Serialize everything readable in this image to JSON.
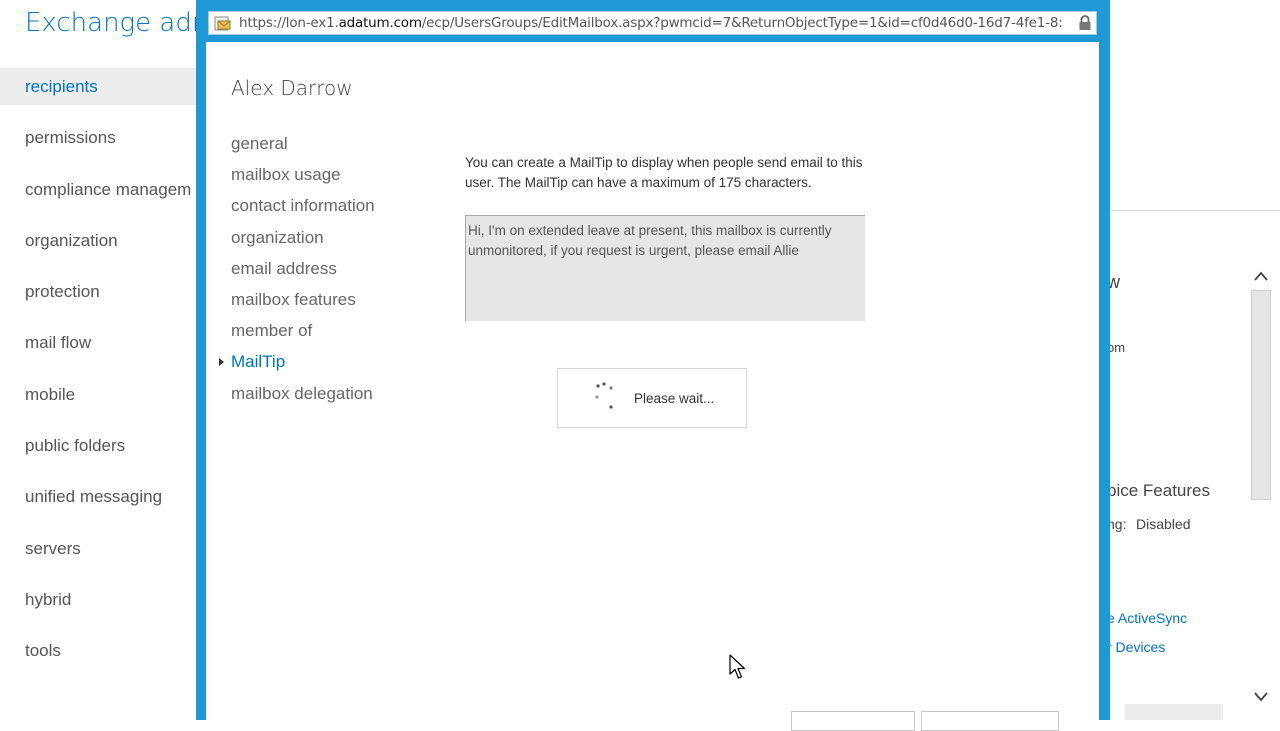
{
  "app": {
    "title": "Exchange adm"
  },
  "leftnav": {
    "items": [
      {
        "label": "recipients",
        "selected": true
      },
      {
        "label": "permissions"
      },
      {
        "label": "compliance managem"
      },
      {
        "label": "organization"
      },
      {
        "label": "protection"
      },
      {
        "label": "mail flow"
      },
      {
        "label": "mobile"
      },
      {
        "label": "public folders"
      },
      {
        "label": "unified messaging"
      },
      {
        "label": "servers"
      },
      {
        "label": "hybrid"
      },
      {
        "label": "tools"
      }
    ]
  },
  "right_panel": {
    "frag_w": "w",
    "frag_om": "om",
    "heading_partial": "pice Features",
    "status_label_partial": "ng:",
    "status_value": "Disabled",
    "link1_partial": "e ActiveSync",
    "link2_partial": "r Devices"
  },
  "browser": {
    "url_prefix": "https://lon-ex1.",
    "url_domain": "adatum.com",
    "url_rest": "/ecp/UsersGroups/EditMailbox.aspx?pwmcid=7&ReturnObjectType=1&id=cf0d46d0-16d7-4fe1-8:"
  },
  "dialog": {
    "user_name": "Alex Darrow",
    "tabs": [
      {
        "label": "general"
      },
      {
        "label": "mailbox usage"
      },
      {
        "label": "contact information"
      },
      {
        "label": "organization"
      },
      {
        "label": "email address"
      },
      {
        "label": "mailbox features"
      },
      {
        "label": "member of"
      },
      {
        "label": "MailTip",
        "selected": true
      },
      {
        "label": "mailbox delegation"
      }
    ],
    "mailtip_description": "You can create a MailTip to display when people send email to this user. The MailTip can have a maximum of 175 characters.",
    "mailtip_text": "Hi, I'm on extended leave at present, this mailbox is currently unmonitored, if you request is urgent, please email Allie",
    "wait_text": "Please wait..."
  },
  "colors": {
    "accent": "#0072c6",
    "modal_border": "#1e99d6",
    "textarea_bg": "#e6e6e6"
  },
  "icons": [
    "envelope-page-icon",
    "lock-icon",
    "spinner-icon",
    "chevron-up-icon",
    "chevron-down-icon",
    "mouse-cursor-icon"
  ]
}
